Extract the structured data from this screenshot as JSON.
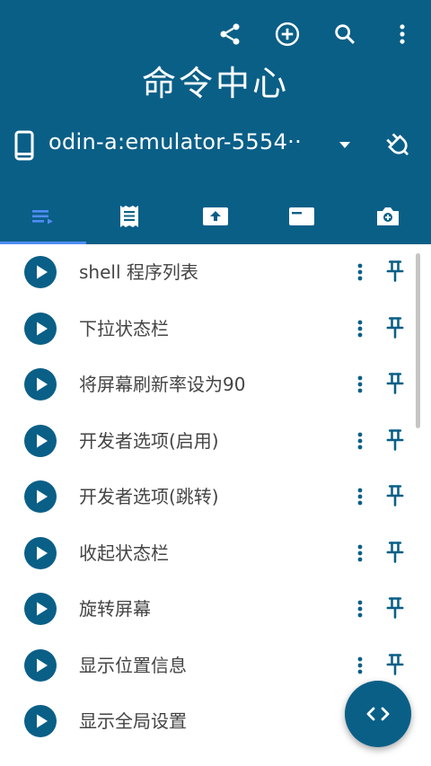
{
  "header": {
    "title": "命令中心",
    "actions": [
      "share-icon",
      "add-circle-icon",
      "search-icon",
      "more-vert-icon"
    ]
  },
  "device": {
    "name": "odin-a:emulator-5554··",
    "icon": "phone-icon",
    "connect_icon": "plug-icon"
  },
  "tabs": [
    {
      "icon": "queue-list-icon",
      "active": true
    },
    {
      "icon": "receipt-icon",
      "active": false
    },
    {
      "icon": "upload-box-icon",
      "active": false
    },
    {
      "icon": "terminal-card-icon",
      "active": false
    },
    {
      "icon": "camera-icon",
      "active": false
    }
  ],
  "commands": [
    {
      "label": "shell 程序列表"
    },
    {
      "label": "下拉状态栏"
    },
    {
      "label": "将屏幕刷新率设为90"
    },
    {
      "label": "开发者选项(启用)"
    },
    {
      "label": "开发者选项(跳转)"
    },
    {
      "label": "收起状态栏"
    },
    {
      "label": "旋转屏幕"
    },
    {
      "label": "显示位置信息"
    },
    {
      "label": "显示全局设置"
    }
  ],
  "fab": {
    "icon": "code-icon"
  },
  "colors": {
    "primary": "#0a5f87",
    "indicator": "#4f8df5",
    "text": "#444444",
    "on_primary": "#ffffff"
  }
}
